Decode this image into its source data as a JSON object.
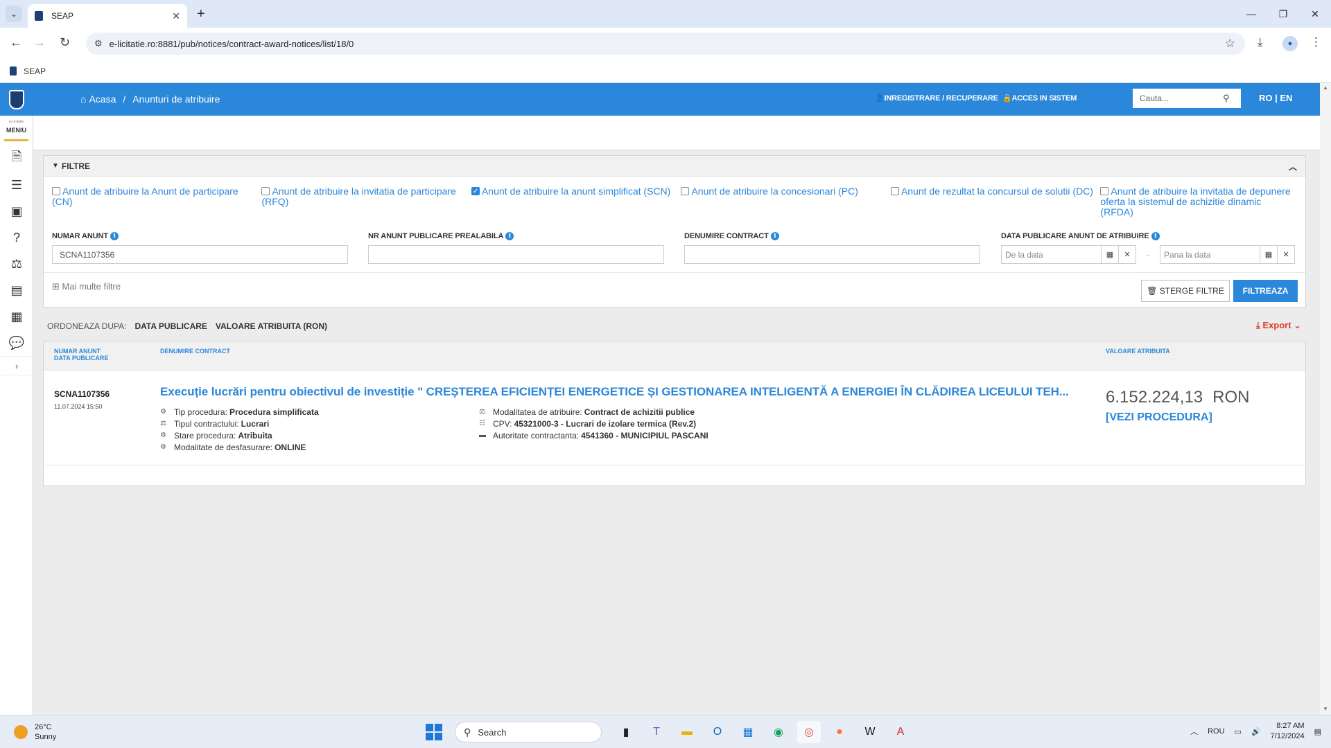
{
  "browser": {
    "tab_title": "SEAP",
    "url": "e-licitatie.ro:8881/pub/notices/contract-award-notices/list/18/0",
    "bookmark": "SEAP"
  },
  "sidebar": {
    "sub_label": "e-Licitatie",
    "menu_label": "MENIU"
  },
  "header": {
    "home": "Acasa",
    "separator": "/",
    "current": "Anunturi de atribuire",
    "register": "INREGISTRARE / RECUPERARE",
    "login": "ACCES IN SISTEM",
    "search_placeholder": "Cauta...",
    "lang_ro": "RO",
    "lang_sep": "|",
    "lang_en": "EN"
  },
  "filters": {
    "title": "FILTRE",
    "checkboxes": [
      {
        "label": "Anunt de atribuire la Anunt de participare (CN)",
        "checked": false
      },
      {
        "label": "Anunt de atribuire la invitatia de participare (RFQ)",
        "checked": false
      },
      {
        "label": "Anunt de atribuire la anunt simplificat (SCN)",
        "checked": true
      },
      {
        "label": "Anunt de atribuire la concesionari (PC)",
        "checked": false
      },
      {
        "label": "Anunt de rezultat la concursul de solutii (DC)",
        "checked": false
      },
      {
        "label": "Anunt de atribuire la invitatia de depunere oferta la sistemul de achizitie dinamic (RFDA)",
        "checked": false
      }
    ],
    "numar_anunt_label": "NUMAR ANUNT",
    "numar_anunt_value": "SCNA1107356",
    "nr_prealabila_label": "NR ANUNT PUBLICARE PREALABILA",
    "denumire_label": "DENUMIRE CONTRACT",
    "data_label": "DATA PUBLICARE ANUNT DE ATRIBUIRE",
    "from_placeholder": "De la data",
    "to_placeholder": "Pana la data",
    "dash": "-",
    "more_filters": "Mai multe filtre",
    "clear_button": "STERGE FILTRE",
    "filter_button": "FILTREAZA"
  },
  "ordering": {
    "label": "ORDONEAZA DUPA:",
    "options": [
      "DATA PUBLICARE",
      "VALOARE ATRIBUITA (RON)"
    ],
    "export": "Export"
  },
  "results": {
    "col_num_line1": "NUMAR ANUNT",
    "col_num_line2": "DATA PUBLICARE",
    "col_name": "DENUMIRE CONTRACT",
    "col_value": "VALOARE ATRIBUITA",
    "item": {
      "number": "SCNA1107356",
      "date": "11.07.2024 15:50",
      "title": "Execuție lucrări pentru obiectivul de investiție \" CREȘTEREA EFICIENȚEI ENERGETICE ȘI GESTIONAREA INTELIGENTĂ A ENERGIEI ÎN CLĂDIREA LICEULUI TEH...",
      "tip_label": "Tip procedura:",
      "tip_value": "Procedura simplificata",
      "tipc_label": "Tipul contractului:",
      "tipc_value": "Lucrari",
      "stare_label": "Stare procedura:",
      "stare_value": "Atribuita",
      "mod_label": "Modalitate de desfasurare:",
      "mod_value": "ONLINE",
      "moda_label": "Modalitatea de atribuire:",
      "moda_value": "Contract de achizitii publice",
      "cpv_label": "CPV:",
      "cpv_value": "45321000-3 - Lucrari de izolare termica (Rev.2)",
      "aut_label": "Autoritate contractanta:",
      "aut_value": "4541360 - MUNICIPIUL PASCANI",
      "value": "6.152.224,13",
      "currency": "RON",
      "vezi": "[VEZI PROCEDURA]"
    }
  },
  "taskbar": {
    "temp": "26°C",
    "weather": "Sunny",
    "search": "Search",
    "lang": "ROU",
    "time": "8:27 AM",
    "date": "7/12/2024"
  }
}
